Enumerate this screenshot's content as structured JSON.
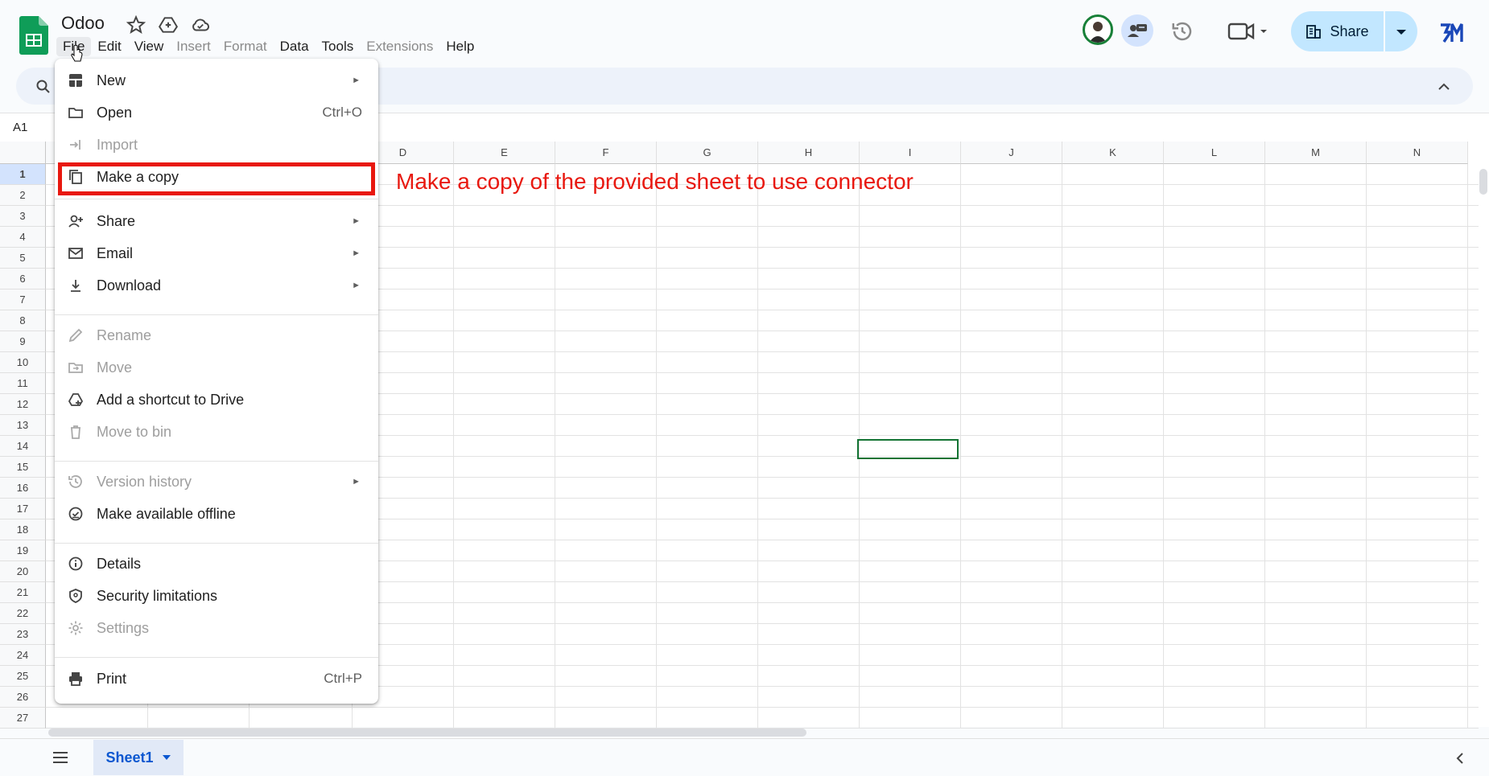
{
  "header": {
    "title": "Odoo",
    "menus": [
      "File",
      "Edit",
      "View",
      "Insert",
      "Format",
      "Data",
      "Tools",
      "Extensions",
      "Help"
    ],
    "share_label": "Share"
  },
  "formula_bar": {
    "cell_ref": "A1"
  },
  "grid": {
    "columns": [
      "D",
      "E",
      "F",
      "G",
      "H",
      "I",
      "J",
      "K",
      "L",
      "M",
      "N"
    ],
    "rows": [
      "1",
      "2",
      "3",
      "4",
      "5",
      "6",
      "7",
      "8",
      "9",
      "10",
      "11",
      "12",
      "13",
      "14",
      "15",
      "16",
      "17",
      "18",
      "19",
      "20",
      "21",
      "22",
      "23",
      "24",
      "25",
      "26",
      "27"
    ]
  },
  "annotation": "Make a copy of the provided sheet to use connector",
  "file_menu": {
    "new": "New",
    "open": "Open",
    "open_shortcut": "Ctrl+O",
    "import": "Import",
    "make_copy": "Make a copy",
    "share": "Share",
    "email": "Email",
    "download": "Download",
    "rename": "Rename",
    "move": "Move",
    "add_shortcut": "Add a shortcut to Drive",
    "move_to_bin": "Move to bin",
    "version_history": "Version history",
    "make_offline": "Make available offline",
    "details": "Details",
    "security": "Security limitations",
    "settings": "Settings",
    "print": "Print",
    "print_shortcut": "Ctrl+P"
  },
  "bottom": {
    "sheet_tab": "Sheet1"
  },
  "colors": {
    "accent": "#0b57d0",
    "share_bg": "#c2e7ff",
    "annotation": "#e8180f",
    "selection": "#137333",
    "sheets_green": "#0f9d58"
  }
}
